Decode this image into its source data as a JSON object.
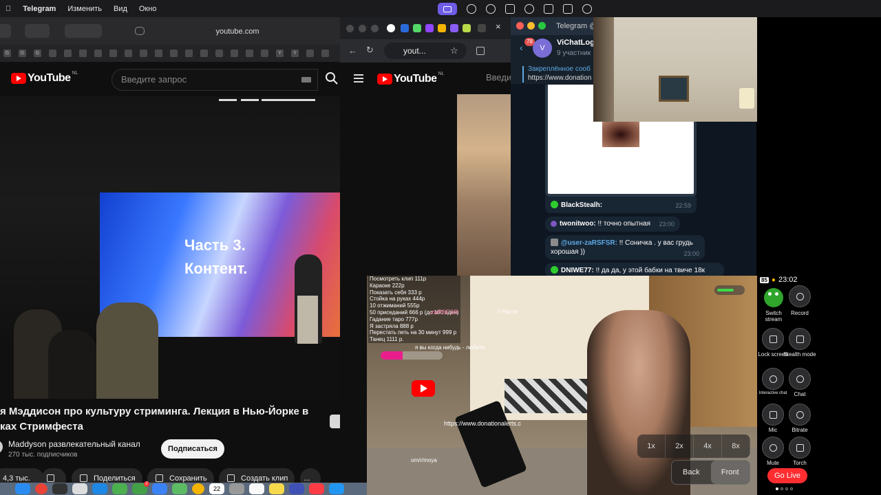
{
  "menubar": {
    "app": "Telegram",
    "items": [
      "Изменить",
      "Вид",
      "Окно"
    ]
  },
  "safari": {
    "address": "youtube.com",
    "favorites": [
      "G",
      "G",
      "G",
      "",
      "",
      "",
      "",
      "",
      "",
      "",
      "",
      "",
      "",
      "",
      "",
      "",
      "",
      "",
      "Y",
      "Y",
      "",
      ""
    ]
  },
  "youtube": {
    "logo": "YouTube",
    "region": "NL",
    "search_placeholder": "Введите запрос",
    "slide_line1": "Часть 3.",
    "slide_line2": "Контент.",
    "video_title_line1": "я Мэддисон про культуру стриминга. Лекция в Нью-Йорке в",
    "video_title_line2": "ках Стримфеста",
    "channel_name": "Maddyson развлекательный канал",
    "subscribers": "270 тыс. подписчиков",
    "subscribe_label": "Подписаться",
    "likes": "4,3 тыс.",
    "share_label": "Поделиться",
    "save_label": "Сохранить",
    "clip_label": "Создать клип",
    "more_label": "..."
  },
  "chrome": {
    "address": "yout...",
    "logo": "YouTube",
    "region": "NL",
    "search_partial": "Введи"
  },
  "telegram": {
    "window_title": "Telegram @",
    "unread_badge": "78",
    "chat_avatar_letter": "V",
    "chat_name": "ViChatLog",
    "members": "9 участник",
    "pinned_label": "Закреплённое сооб",
    "pinned_text": "https://www.donation",
    "messages": [
      {
        "author": "BlackStealh:",
        "text": "",
        "time": "22:59",
        "color": "#2ecc2e"
      },
      {
        "author": "twonitwoo:",
        "text": "!! точно опытная",
        "time": "23:00",
        "color": "#7e57c2"
      },
      {
        "author": "@user-zaRSFSR:",
        "text": "!! Соничка . у вас грудь хорошая ))",
        "time": "23:00",
        "color": "#8b8b8b"
      },
      {
        "author": "DNIWE77:",
        "text": "!! да да, у этой бабки на твиче 18к",
        "time": "",
        "color": "#2ecc2e"
      }
    ]
  },
  "stream": {
    "donations": [
      "Посмотреть клип 111р",
      "Караоке 222р",
      "Показать себя 333 р",
      "Стойка на руках 444р",
      "10 отжиманий 555р",
      "50 приседаний 666 р (до 100 вдеи)",
      "Гадание таро 777р",
      "Я застряла 888 р",
      "Перестать петь на 30 минут 999 р",
      "Танец 1111 р."
    ],
    "ticker_user": "-zaRSFSR",
    "ticker_text": "!! Настя",
    "ticker_line": "я вы когда нибудь - любите",
    "url": "https://www.donationalerts.c",
    "url2": "om/r/moya",
    "progress": 0.35,
    "zoom_options": [
      "1x",
      "2x",
      "4x",
      "8x"
    ],
    "camera_options": [
      "Back",
      "Front"
    ],
    "camera_selected": "Front"
  },
  "panel": {
    "battery": "85",
    "time": "23:02",
    "controls": [
      {
        "label": "Switch stream"
      },
      {
        "label": "Record"
      },
      {
        "label": "Lock screen"
      },
      {
        "label": "Stealth mode"
      },
      {
        "label": "Interactive chat"
      },
      {
        "label": "Chat"
      },
      {
        "label": "Mic"
      },
      {
        "label": "Bitrate"
      },
      {
        "label": "Mute"
      },
      {
        "label": "Torch"
      }
    ],
    "go_live_label": "Go Live"
  },
  "dock": {
    "calendar_day": "22",
    "badge": "2"
  },
  "colors": {
    "youtube_red": "#ff0000",
    "telegram_bg": "#0e1621",
    "go_live": "#ff2d30",
    "accent_purple": "#6f5ce6"
  }
}
